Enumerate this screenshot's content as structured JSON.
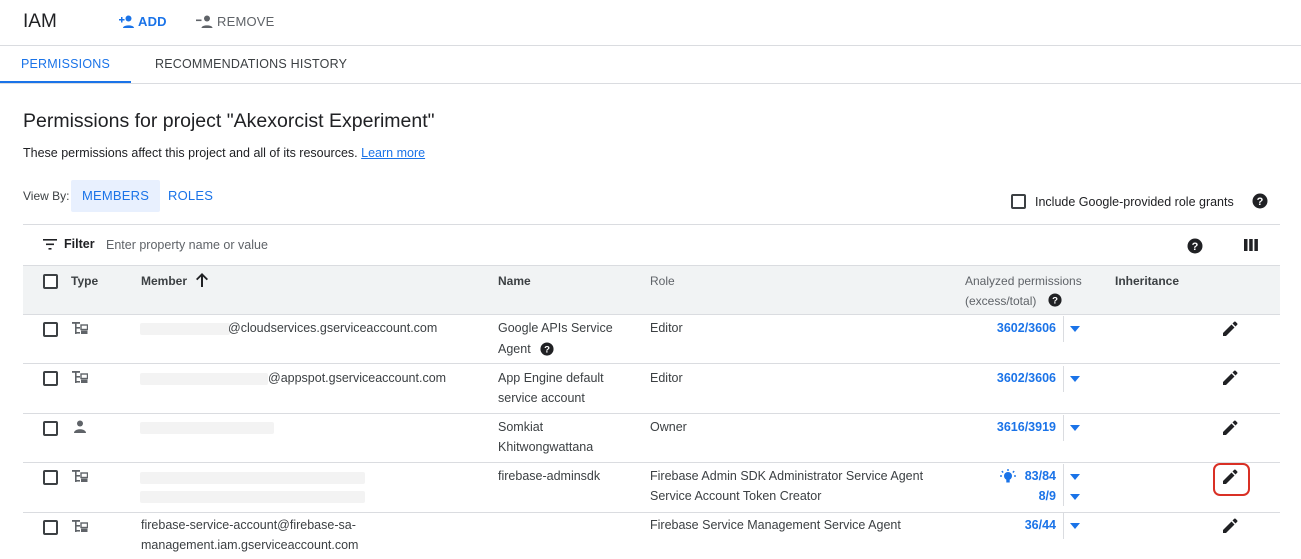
{
  "header": {
    "title": "IAM",
    "add_label": "ADD",
    "remove_label": "REMOVE"
  },
  "tabs": {
    "permissions": "PERMISSIONS",
    "history": "RECOMMENDATIONS HISTORY"
  },
  "page": {
    "title": "Permissions for project \"Akexorcist Experiment\"",
    "subtitle": "These permissions affect this project and all of its resources.",
    "learn_more": "Learn more"
  },
  "view_by": {
    "label": "View By:",
    "members": "MEMBERS",
    "roles": "ROLES",
    "selected": "MEMBERS"
  },
  "include_google_grants": {
    "label": "Include Google-provided role grants",
    "checked": false
  },
  "filter": {
    "label": "Filter",
    "placeholder": "Enter property name or value"
  },
  "table": {
    "headers": {
      "type": "Type",
      "member": "Member",
      "name": "Name",
      "role": "Role",
      "analyzed_1": "Analyzed permissions",
      "analyzed_2": "(excess/total)",
      "inheritance": "Inheritance"
    },
    "rows": [
      {
        "type_icon": "service-account-icon",
        "member": "@cloudservices.gserviceaccount.com",
        "name_1": "Google APIs Service",
        "name_2": "Agent",
        "role_1": "Editor",
        "perm_1": "3602/3606"
      },
      {
        "type_icon": "service-account-icon",
        "member": "@appspot.gserviceaccount.com",
        "name_1": "App Engine default",
        "name_2": "service account",
        "role_1": "Editor",
        "perm_1": "3602/3606"
      },
      {
        "type_icon": "person-icon",
        "member": "",
        "name_1": "Somkiat",
        "name_2": "Khitwongwattana",
        "role_1": "Owner",
        "perm_1": "3616/3919"
      },
      {
        "type_icon": "service-account-icon",
        "member": "",
        "name_1": "firebase-adminsdk",
        "role_1": "Firebase Admin SDK Administrator Service Agent",
        "role_2": "Service Account Token Creator",
        "perm_1": "83/84",
        "perm_2": "8/9",
        "recommendation_icon": "lightbulb-icon"
      },
      {
        "type_icon": "service-account-icon",
        "member_1": "firebase-service-account@firebase-sa-",
        "member_2": "management.iam.gserviceaccount.com",
        "role_1": "Firebase Service Management Service Agent",
        "perm_1": "36/44"
      }
    ]
  },
  "colors": {
    "accent": "#1a73e8",
    "highlight": "#d93025",
    "header_bg": "#f1f3f4"
  }
}
